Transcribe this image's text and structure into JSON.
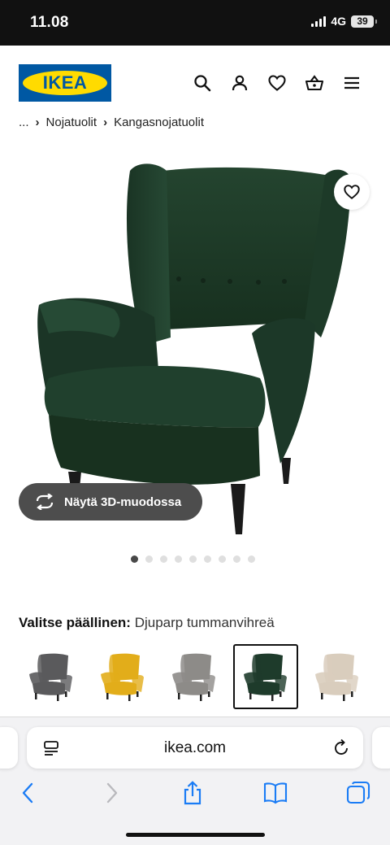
{
  "status_bar": {
    "time": "11.08",
    "network": "4G",
    "battery": "39"
  },
  "header": {
    "logo_text": "IKEA",
    "icons": [
      "search-icon",
      "user-icon",
      "heart-icon",
      "basket-icon",
      "menu-icon"
    ]
  },
  "breadcrumb": {
    "ellipsis": "...",
    "items": [
      "Nojatuolit",
      "Kangasnojatuolit"
    ],
    "separator": "›"
  },
  "product": {
    "view_3d_label": "Näytä 3D-muodossa",
    "image_count": 9,
    "active_image": 1
  },
  "variant": {
    "prefix": "Valitse päällinen:",
    "selected": "Djuparp tummanvihreä",
    "swatches": [
      {
        "color": "#5a5a5c"
      },
      {
        "color": "#e2ad1a"
      },
      {
        "color": "#8d8b88"
      },
      {
        "color": "#1e3b2b",
        "selected": true
      },
      {
        "color": "#d9cdbd"
      }
    ]
  },
  "browser": {
    "url": "ikea.com"
  },
  "colors": {
    "ikea_blue": "#0058a3",
    "ikea_yellow": "#ffdb00",
    "chair_green": "#1f3a2b",
    "safari_blue": "#1a7cf5"
  }
}
